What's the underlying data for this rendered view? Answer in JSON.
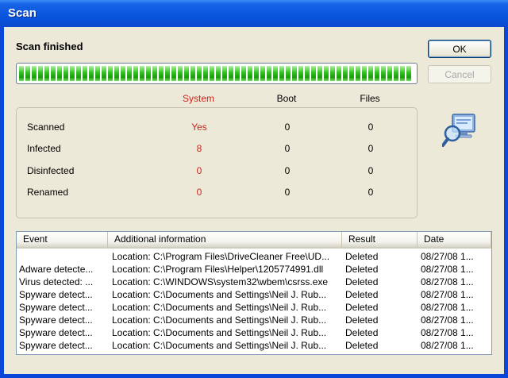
{
  "window": {
    "title": "Scan"
  },
  "status": {
    "title": "Scan finished",
    "progress_percent": 100
  },
  "buttons": {
    "ok_label": "OK",
    "cancel_label": "Cancel"
  },
  "stats": {
    "columns": [
      "System",
      "Boot",
      "Files"
    ],
    "rows": [
      {
        "label": "Scanned",
        "values": [
          "Yes",
          "0",
          "0"
        ]
      },
      {
        "label": "Infected",
        "values": [
          "8",
          "0",
          "0"
        ]
      },
      {
        "label": "Disinfected",
        "values": [
          "0",
          "0",
          "0"
        ]
      },
      {
        "label": "Renamed",
        "values": [
          "0",
          "0",
          "0"
        ]
      }
    ]
  },
  "icon": "scan-monitor-magnifier-icon",
  "colors": {
    "title_bar": "#0a55dd",
    "client_bg": "#ece9d8",
    "highlight_red": "#c8251d",
    "progress_green": "#2fc01e"
  },
  "events": {
    "columns": [
      "Event",
      "Additional information",
      "Result",
      "Date"
    ],
    "rows": [
      [
        "",
        "Location: C:\\Program Files\\DriveCleaner Free\\UD...",
        "Deleted",
        "08/27/08 1..."
      ],
      [
        "Adware detecte...",
        "Location: C:\\Program Files\\Helper\\1205774991.dll",
        "Deleted",
        "08/27/08 1..."
      ],
      [
        "Virus detected: ...",
        "Location: C:\\WINDOWS\\system32\\wbem\\csrss.exe",
        "Deleted",
        "08/27/08 1..."
      ],
      [
        "Spyware detect...",
        "Location: C:\\Documents and Settings\\Neil J. Rub...",
        "Deleted",
        "08/27/08 1..."
      ],
      [
        "Spyware detect...",
        "Location: C:\\Documents and Settings\\Neil J. Rub...",
        "Deleted",
        "08/27/08 1..."
      ],
      [
        "Spyware detect...",
        "Location: C:\\Documents and Settings\\Neil J. Rub...",
        "Deleted",
        "08/27/08 1..."
      ],
      [
        "Spyware detect...",
        "Location: C:\\Documents and Settings\\Neil J. Rub...",
        "Deleted",
        "08/27/08 1..."
      ],
      [
        "Spyware detect...",
        "Location: C:\\Documents and Settings\\Neil J. Rub...",
        "Deleted",
        "08/27/08 1..."
      ]
    ]
  }
}
